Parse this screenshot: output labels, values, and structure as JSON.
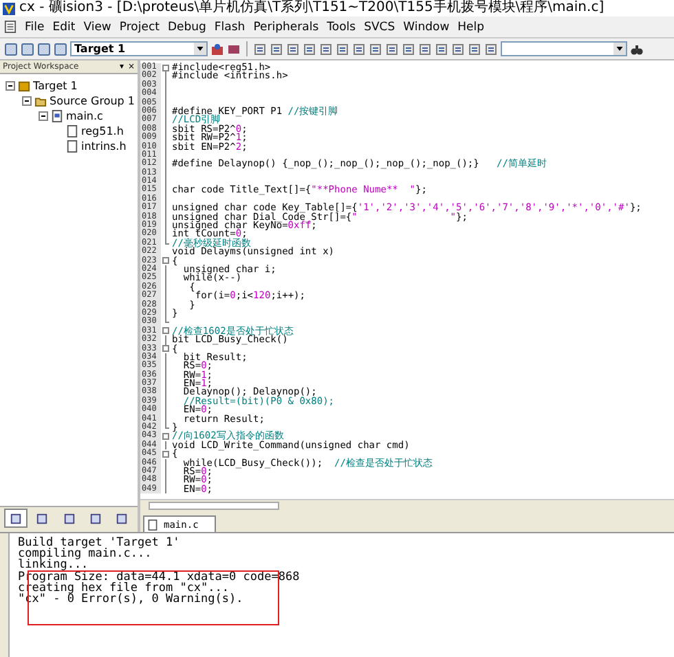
{
  "window": {
    "title": "cx - 礦ision3 - [D:\\proteus\\单片机仿真\\T系列\\T151~T200\\T155手机拨号模块\\程序\\main.c]"
  },
  "menu": [
    "File",
    "Edit",
    "View",
    "Project",
    "Debug",
    "Flash",
    "Peripherals",
    "Tools",
    "SVCS",
    "Window",
    "Help"
  ],
  "toolbar": {
    "target": "Target 1"
  },
  "workspace": {
    "title": "Project Workspace",
    "pin": "▾",
    "close": "×",
    "tree": [
      {
        "label": "Target 1",
        "kind": "target",
        "expanded": true,
        "children": [
          {
            "label": "Source Group 1",
            "kind": "group",
            "expanded": true,
            "children": [
              {
                "label": "main.c",
                "kind": "source",
                "expanded": true,
                "children": [
                  {
                    "label": "reg51.h",
                    "kind": "header"
                  },
                  {
                    "label": "intrins.h",
                    "kind": "header"
                  }
                ]
              }
            ]
          }
        ]
      }
    ],
    "tabs": [
      {
        "selected": true
      },
      {
        "selected": false
      },
      {
        "selected": false
      },
      {
        "selected": false
      },
      {
        "selected": false
      }
    ]
  },
  "editor": {
    "tab": "main.c",
    "lines": [
      {
        "n": "001",
        "kind": "open",
        "segs": [
          {
            "text": "#include<reg51.h>",
            "kind": "code"
          }
        ]
      },
      {
        "n": "002",
        "kind": "line",
        "segs": [
          {
            "text": "#include <intrins.h>",
            "kind": "code"
          }
        ]
      },
      {
        "n": "003",
        "kind": "line"
      },
      {
        "n": "004",
        "kind": "line"
      },
      {
        "n": "005",
        "kind": "line"
      },
      {
        "n": "006",
        "kind": "line",
        "segs": [
          {
            "text": "#define KEY_PORT P1 ",
            "kind": "code"
          },
          {
            "text": "//按键引脚",
            "kind": "comment"
          }
        ]
      },
      {
        "n": "007",
        "kind": "line",
        "segs": [
          {
            "text": "//LCD引脚",
            "kind": "comment"
          }
        ]
      },
      {
        "n": "008",
        "kind": "line",
        "segs": [
          {
            "text": "sbit RS=P2^",
            "kind": "code"
          },
          {
            "text": "0",
            "kind": "literal"
          },
          {
            "text": ";",
            "kind": "code"
          }
        ]
      },
      {
        "n": "009",
        "kind": "line",
        "segs": [
          {
            "text": "sbit RW=P2^",
            "kind": "code"
          },
          {
            "text": "1",
            "kind": "literal"
          },
          {
            "text": ";",
            "kind": "code"
          }
        ]
      },
      {
        "n": "010",
        "kind": "line",
        "segs": [
          {
            "text": "sbit EN=P2^",
            "kind": "code"
          },
          {
            "text": "2",
            "kind": "literal"
          },
          {
            "text": ";",
            "kind": "code"
          }
        ]
      },
      {
        "n": "011",
        "kind": "line"
      },
      {
        "n": "012",
        "kind": "line",
        "segs": [
          {
            "text": "#define Delaynop() {_nop_();_nop_();_nop_();_nop_();}   ",
            "kind": "code"
          },
          {
            "text": "//简单延时",
            "kind": "comment"
          }
        ]
      },
      {
        "n": "013",
        "kind": "line"
      },
      {
        "n": "014",
        "kind": "line"
      },
      {
        "n": "015",
        "kind": "line",
        "segs": [
          {
            "text": "char code Title_Text[]={",
            "kind": "code"
          },
          {
            "text": "\"**Phone Nume**  \"",
            "kind": "literal"
          },
          {
            "text": "};",
            "kind": "code"
          }
        ]
      },
      {
        "n": "016",
        "kind": "line"
      },
      {
        "n": "017",
        "kind": "line",
        "segs": [
          {
            "text": "unsigned char code Key_Table[]={",
            "kind": "code"
          },
          {
            "text": "'1','2','3','4','5','6','7','8','9','*','0','#'",
            "kind": "literal"
          },
          {
            "text": "};",
            "kind": "code"
          }
        ]
      },
      {
        "n": "018",
        "kind": "line",
        "segs": [
          {
            "text": "unsigned char Dial_Code_Str[]={",
            "kind": "code"
          },
          {
            "text": "\"                \"",
            "kind": "literal"
          },
          {
            "text": "};",
            "kind": "code"
          }
        ]
      },
      {
        "n": "019",
        "kind": "line",
        "segs": [
          {
            "text": "unsigned char KeyNo=",
            "kind": "code"
          },
          {
            "text": "0xff",
            "kind": "literal"
          },
          {
            "text": ";",
            "kind": "code"
          }
        ]
      },
      {
        "n": "020",
        "kind": "line",
        "segs": [
          {
            "text": "int tCount=",
            "kind": "code"
          },
          {
            "text": "0",
            "kind": "literal"
          },
          {
            "text": ";",
            "kind": "code"
          }
        ]
      },
      {
        "n": "021",
        "kind": "end",
        "segs": [
          {
            "text": "//毫秒级延时函数",
            "kind": "comment"
          }
        ]
      },
      {
        "n": "022",
        "kind": "plain",
        "segs": [
          {
            "text": "void Delayms(unsigned int x)",
            "kind": "code"
          }
        ]
      },
      {
        "n": "023",
        "kind": "open",
        "segs": [
          {
            "text": "{",
            "kind": "code"
          }
        ]
      },
      {
        "n": "024",
        "kind": "line",
        "segs": [
          {
            "text": "  unsigned char i;",
            "kind": "code"
          }
        ]
      },
      {
        "n": "025",
        "kind": "line",
        "segs": [
          {
            "text": "  while(x--)",
            "kind": "code"
          }
        ]
      },
      {
        "n": "026",
        "kind": "line",
        "segs": [
          {
            "text": "   {",
            "kind": "code"
          }
        ]
      },
      {
        "n": "027",
        "kind": "line",
        "segs": [
          {
            "text": "    for(i=",
            "kind": "code"
          },
          {
            "text": "0",
            "kind": "literal"
          },
          {
            "text": ";i<",
            "kind": "code"
          },
          {
            "text": "120",
            "kind": "literal"
          },
          {
            "text": ";i++);",
            "kind": "code"
          }
        ]
      },
      {
        "n": "028",
        "kind": "line",
        "segs": [
          {
            "text": "   }",
            "kind": "code"
          }
        ]
      },
      {
        "n": "029",
        "kind": "line",
        "segs": [
          {
            "text": "}",
            "kind": "code"
          }
        ]
      },
      {
        "n": "030",
        "kind": "end"
      },
      {
        "n": "031",
        "kind": "open",
        "segs": [
          {
            "text": "//检查1602是否处于忙状态",
            "kind": "comment"
          }
        ]
      },
      {
        "n": "032",
        "kind": "line",
        "segs": [
          {
            "text": "bit LCD_Busy_Check()",
            "kind": "code"
          }
        ]
      },
      {
        "n": "033",
        "kind": "open",
        "segs": [
          {
            "text": "{",
            "kind": "code"
          }
        ]
      },
      {
        "n": "034",
        "kind": "line",
        "segs": [
          {
            "text": "  bit Result;",
            "kind": "code"
          }
        ]
      },
      {
        "n": "035",
        "kind": "line",
        "segs": [
          {
            "text": "  RS=",
            "kind": "code"
          },
          {
            "text": "0",
            "kind": "literal"
          },
          {
            "text": ";",
            "kind": "code"
          }
        ]
      },
      {
        "n": "036",
        "kind": "line",
        "segs": [
          {
            "text": "  RW=",
            "kind": "code"
          },
          {
            "text": "1",
            "kind": "literal"
          },
          {
            "text": ";",
            "kind": "code"
          }
        ]
      },
      {
        "n": "037",
        "kind": "line",
        "segs": [
          {
            "text": "  EN=",
            "kind": "code"
          },
          {
            "text": "1",
            "kind": "literal"
          },
          {
            "text": ";",
            "kind": "code"
          }
        ]
      },
      {
        "n": "038",
        "kind": "line",
        "segs": [
          {
            "text": "  Delaynop(); Delaynop();",
            "kind": "code"
          }
        ]
      },
      {
        "n": "039",
        "kind": "line",
        "segs": [
          {
            "text": "  //Result=(bit)(P0 & 0x80);",
            "kind": "comment"
          }
        ]
      },
      {
        "n": "040",
        "kind": "line",
        "segs": [
          {
            "text": "  EN=",
            "kind": "code"
          },
          {
            "text": "0",
            "kind": "literal"
          },
          {
            "text": ";",
            "kind": "code"
          }
        ]
      },
      {
        "n": "041",
        "kind": "line",
        "segs": [
          {
            "text": "  return Result;",
            "kind": "code"
          }
        ]
      },
      {
        "n": "042",
        "kind": "end",
        "segs": [
          {
            "text": "}",
            "kind": "code"
          }
        ]
      },
      {
        "n": "043",
        "kind": "open",
        "segs": [
          {
            "text": "//向1602写入指令的函数",
            "kind": "comment"
          }
        ]
      },
      {
        "n": "044",
        "kind": "line",
        "segs": [
          {
            "text": "void LCD_Write_Command(unsigned char cmd)",
            "kind": "code"
          }
        ]
      },
      {
        "n": "045",
        "kind": "open",
        "segs": [
          {
            "text": "{",
            "kind": "code"
          }
        ]
      },
      {
        "n": "046",
        "kind": "line",
        "segs": [
          {
            "text": "  while(LCD_Busy_Check());  ",
            "kind": "code"
          },
          {
            "text": "//检查是否处于忙状态",
            "kind": "comment"
          }
        ]
      },
      {
        "n": "047",
        "kind": "line",
        "segs": [
          {
            "text": "  RS=",
            "kind": "code"
          },
          {
            "text": "0",
            "kind": "literal"
          },
          {
            "text": ";",
            "kind": "code"
          }
        ]
      },
      {
        "n": "048",
        "kind": "line",
        "segs": [
          {
            "text": "  RW=",
            "kind": "code"
          },
          {
            "text": "0",
            "kind": "literal"
          },
          {
            "text": ";",
            "kind": "code"
          }
        ]
      },
      {
        "n": "049",
        "kind": "line",
        "segs": [
          {
            "text": "  EN=",
            "kind": "code"
          },
          {
            "text": "0",
            "kind": "literal"
          },
          {
            "text": ";",
            "kind": "code"
          }
        ]
      }
    ]
  },
  "output": {
    "lines": [
      "Build target 'Target 1'",
      "compiling main.c...",
      "linking...",
      "Program Size: data=44.1 xdata=0 code=868",
      "creating hex file from \"cx\"...",
      "\"cx\" - 0 Error(s), 0 Warning(s)."
    ]
  }
}
